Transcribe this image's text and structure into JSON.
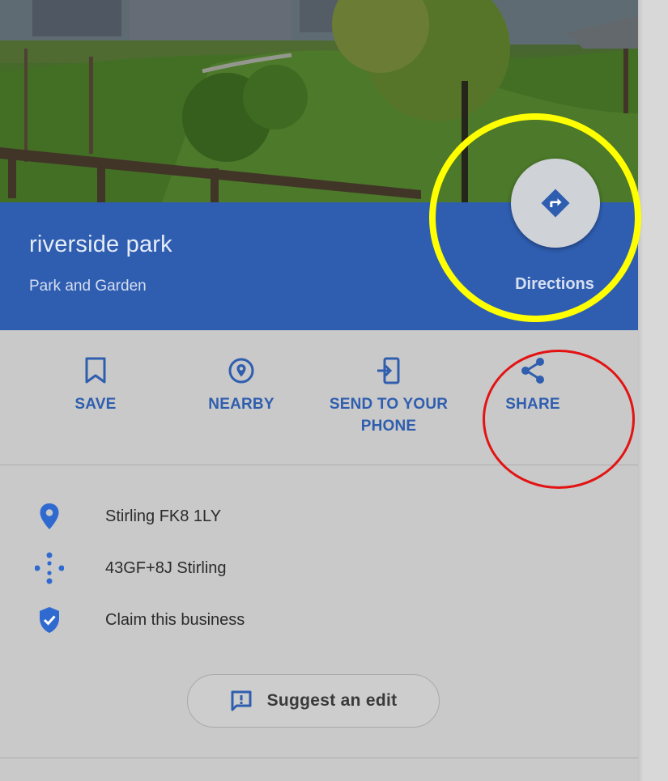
{
  "place": {
    "title": "riverside park",
    "category": "Park and Garden"
  },
  "directions": {
    "label": "Directions",
    "icon": "directions-icon"
  },
  "actions": [
    {
      "label": "SAVE",
      "icon": "bookmark-icon"
    },
    {
      "label": "NEARBY",
      "icon": "nearby-icon"
    },
    {
      "label": "SEND TO YOUR PHONE",
      "icon": "send-to-phone-icon"
    },
    {
      "label": "SHARE",
      "icon": "share-icon"
    }
  ],
  "info": {
    "address": "Stirling FK8 1LY",
    "plus_code": "43GF+8J Stirling",
    "claim": "Claim this business"
  },
  "suggest_edit": {
    "label": "Suggest an edit",
    "icon": "feedback-icon"
  },
  "colors": {
    "header_blue": "#2f5eb1",
    "action_blue": "#2f5eaf",
    "annotation_yellow": "#ffff00",
    "annotation_red": "#e31313"
  }
}
